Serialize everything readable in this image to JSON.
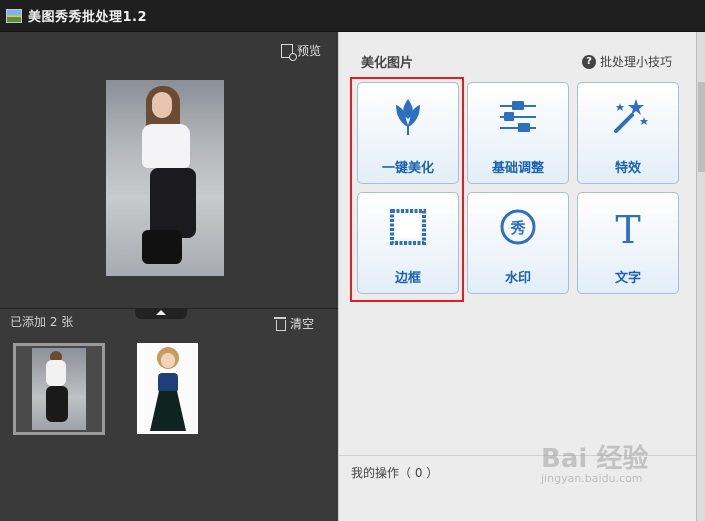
{
  "window": {
    "title": "美图秀秀批处理1.2"
  },
  "left_panel": {
    "preview_label": "预览",
    "added_count_label": "已添加 2 张",
    "clear_label": "清空",
    "thumbnails": [
      {
        "selected": true
      },
      {
        "selected": false
      }
    ]
  },
  "right_panel": {
    "title": "美化图片",
    "tips_label": "批处理小技巧",
    "tools": [
      {
        "label": "一键美化",
        "icon": "tulip-icon",
        "highlighted": true
      },
      {
        "label": "基础调整",
        "icon": "sliders-icon",
        "highlighted": false
      },
      {
        "label": "特效",
        "icon": "magic-wand-icon",
        "highlighted": false
      },
      {
        "label": "边框",
        "icon": "frame-icon",
        "highlighted": true
      },
      {
        "label": "水印",
        "icon": "watermark-icon",
        "highlighted": false
      },
      {
        "label": "文字",
        "icon": "text-icon",
        "highlighted": false
      }
    ],
    "my_operations_label": "我的操作（ 0 ）"
  },
  "watermark": {
    "brand": "Bai 经验",
    "url": "jingyan.baidu.com"
  },
  "colors": {
    "accent_blue": "#1a62b0",
    "highlight_red": "#e02020",
    "titlebar": "#1f1f1f"
  }
}
